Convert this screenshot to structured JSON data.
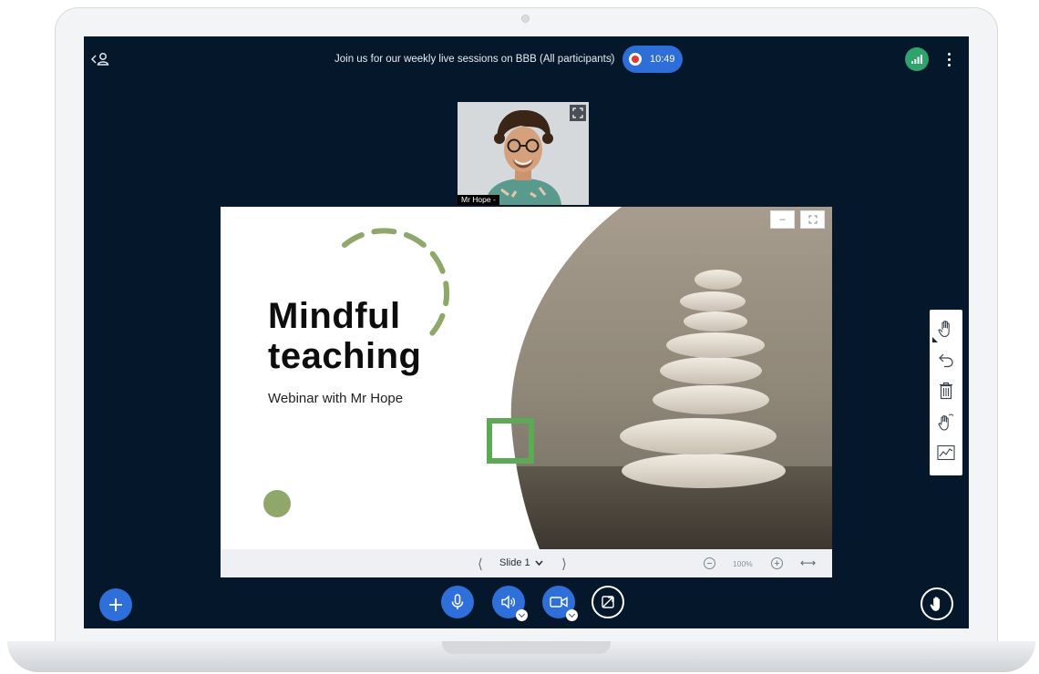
{
  "header": {
    "session_title": "Join us for our weekly live sessions on BBB (All participants)",
    "recording_time": "10:49"
  },
  "webcam": {
    "name": "Mr Hope -"
  },
  "slide": {
    "title_line1": "Mindful",
    "title_line2": "teaching",
    "subtitle": "Webinar with Mr Hope"
  },
  "slide_toolbar": {
    "current_slide": "Slide 1",
    "zoom_level": "100%"
  },
  "whiteboard_tools": [
    "hand-tool-icon",
    "undo-icon",
    "trash-icon",
    "multi-user-icon",
    "chart-icon"
  ],
  "colors": {
    "screen_bg": "#05172a",
    "accent_blue": "#2f6fd9",
    "connection_green": "#2ea36c",
    "slide_green": "#8fa86a"
  }
}
